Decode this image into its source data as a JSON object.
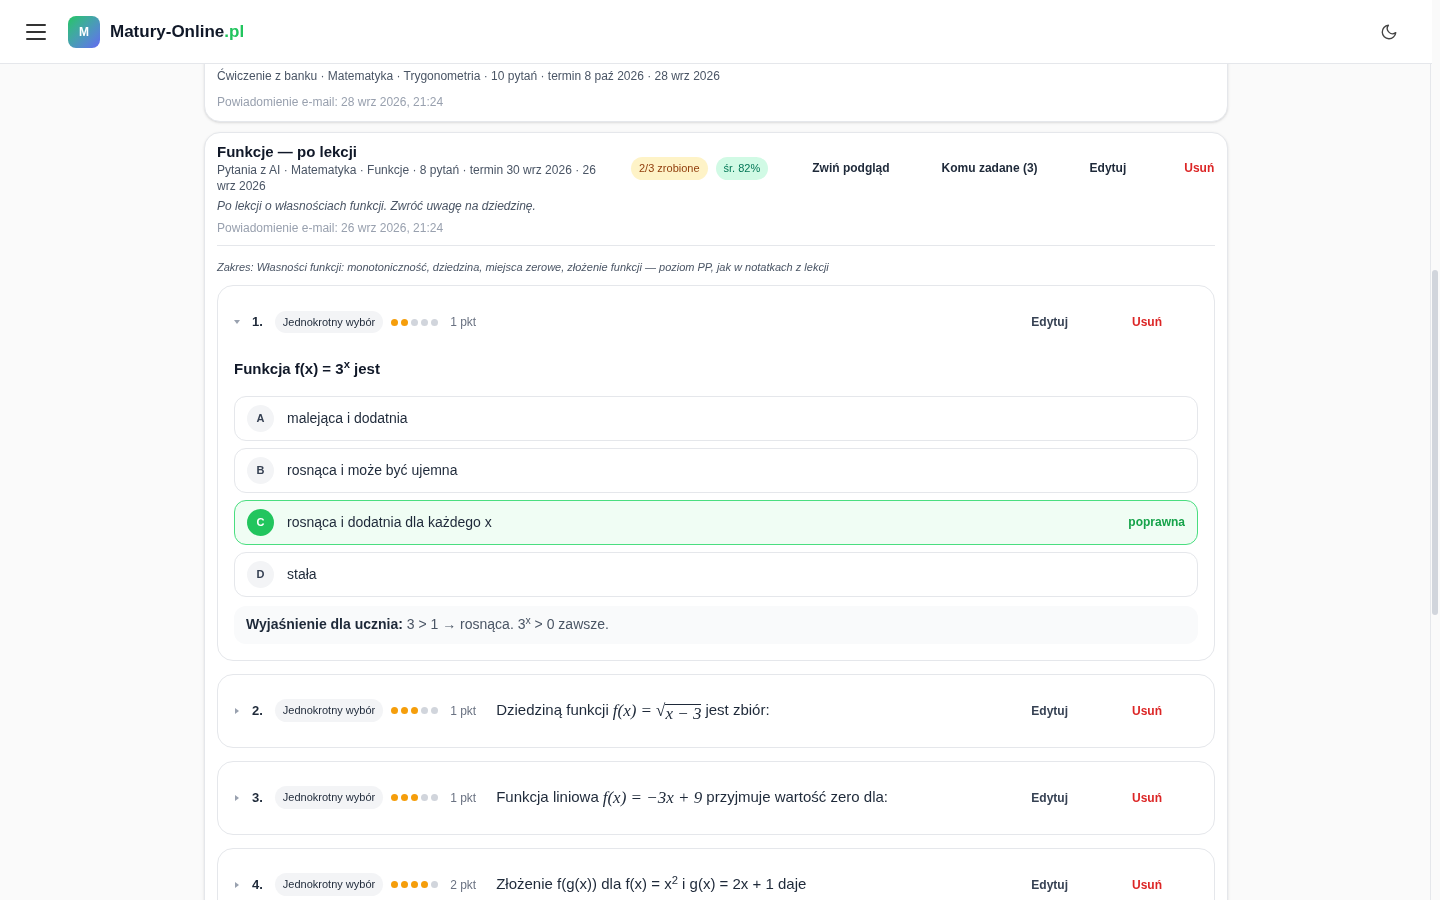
{
  "header": {
    "logo_letter": "M",
    "brand": "Matury-Online",
    "brand_suffix": ".pl"
  },
  "top_card": {
    "meta": "Ćwiczenie z banku · Matematyka · Trygonometria · 10 pytań · termin 8 paź 2026 · 28 wrz 2026",
    "email": "Powiadomienie e-mail: 28 wrz 2026, 21:24"
  },
  "card": {
    "title": "Funkcje — po lekcji",
    "meta": "Pytania z AI · Matematyka · Funkcje · 8 pytań · termin 30 wrz 2026 · 26 wrz 2026",
    "note": "Po lekcji o własnościach funkcji. Zwróć uwagę na dziedzinę.",
    "email": "Powiadomienie e-mail: 26 wrz 2026, 21:24",
    "progress": "2/3 zrobione",
    "average": "śr. 82%",
    "collapse": "Zwiń podgląd",
    "assigned": "Komu zadane (3)",
    "edit": "Edytuj",
    "delete": "Usuń",
    "scope": "Zakres: Własności funkcji: monotoniczność, dziedzina, miejsca zerowe, złożenie funkcji — poziom PP, jak w notatkach z lekcji"
  },
  "questions": [
    {
      "number": "1.",
      "type": "Jednokrotny wybór",
      "stars": 2,
      "points": "1 pkt",
      "expanded": true,
      "edit": "Edytuj",
      "delete": "Usuń",
      "text": [
        {
          "kind": "text",
          "text": "Funkcja f(x) = 3$^{x}$ jest"
        }
      ],
      "options": [
        {
          "letter": "A",
          "text": "malejąca i dodatnia",
          "correct": false
        },
        {
          "letter": "B",
          "text": "rosnąca i może być ujemna",
          "correct": false
        },
        {
          "letter": "C",
          "text": "rosnąca i dodatnia dla każdego x",
          "correct": true
        },
        {
          "letter": "D",
          "text": "stała",
          "correct": false
        }
      ],
      "correct_label": "poprawna",
      "explanation": "**Wyjaśnienie dla ucznia:** 3 > 1 → rosnąca. 3$^{x}$ > 0 zawsze."
    },
    {
      "number": "2.",
      "type": "Jednokrotny wybór",
      "stars": 3,
      "points": "1 pkt",
      "expanded": false,
      "edit": "Edytuj",
      "delete": "Usuń",
      "text": [
        {
          "kind": "text",
          "text": "Dziedziną funkcji"
        },
        {
          "kind": "math",
          "text": "f(x) ="
        },
        {
          "kind": "sqrt",
          "radical": "√",
          "text": "x − 3"
        },
        {
          "kind": "text",
          "text": "jest zbiór:"
        }
      ]
    },
    {
      "number": "3.",
      "type": "Jednokrotny wybór",
      "stars": 3,
      "points": "1 pkt",
      "expanded": false,
      "edit": "Edytuj",
      "delete": "Usuń",
      "text": [
        {
          "kind": "text",
          "text": "Funkcja liniowa"
        },
        {
          "kind": "math",
          "text": "f(x) = −3x + 9"
        },
        {
          "kind": "text",
          "text": "przyjmuje wartość zero dla:"
        }
      ]
    },
    {
      "number": "4.",
      "type": "Jednokrotny wybór",
      "stars": 4,
      "points": "2 pkt",
      "expanded": false,
      "edit": "Edytuj",
      "delete": "Usuń",
      "text": [
        {
          "kind": "text",
          "text": "Złożenie f(g(x)) dla f(x) = x$^{2}$ i g(x) = 2x + 1 daje"
        }
      ]
    }
  ]
}
